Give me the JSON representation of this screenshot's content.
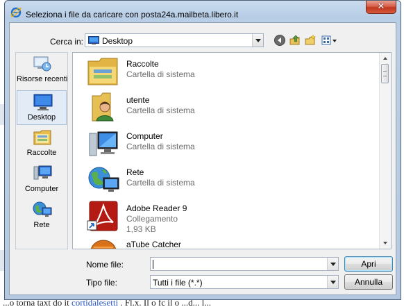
{
  "dialog": {
    "title": "Seleziona i file da caricare con posta24a.mailbeta.libero.it",
    "close_label": "✕"
  },
  "lookin": {
    "label": "Cerca in:",
    "value": "Desktop"
  },
  "toolbar": {
    "icons": [
      "back-icon",
      "up-folder-icon",
      "new-folder-icon",
      "view-menu-icon"
    ]
  },
  "places": [
    {
      "label": "Risorse recenti",
      "icon": "recent-places-icon"
    },
    {
      "label": "Desktop",
      "icon": "desktop-icon",
      "active": true
    },
    {
      "label": "Raccolte",
      "icon": "libraries-icon"
    },
    {
      "label": "Computer",
      "icon": "computer-icon"
    },
    {
      "label": "Rete",
      "icon": "network-icon"
    }
  ],
  "files": [
    {
      "name": "Raccolte",
      "desc": "Cartella di sistema",
      "icon": "libraries-icon"
    },
    {
      "name": "utente",
      "desc": "Cartella di sistema",
      "icon": "user-folder-icon"
    },
    {
      "name": "Computer",
      "desc": "Cartella di sistema",
      "icon": "computer-icon"
    },
    {
      "name": "Rete",
      "desc": "Cartella di sistema",
      "icon": "network-icon"
    },
    {
      "name": "Adobe Reader 9",
      "desc": "Collegamento",
      "size": "1,93 KB",
      "icon": "adobe-reader-icon"
    },
    {
      "name": "aTube Catcher",
      "icon": "atube-catcher-icon"
    }
  ],
  "filename": {
    "label": "Nome file:",
    "value": ""
  },
  "filetype": {
    "label": "Tipo file:",
    "value": "Tutti i file (*.*)"
  },
  "buttons": {
    "open": "Apri",
    "cancel": "Annulla"
  },
  "background_text": {
    "prefix": "...o torna taxt do it",
    "link": "cortidalesetti",
    "suffix": ". Fl.x. Il o fc il o ...d... l..."
  },
  "colors": {
    "close_button": "#c9452b",
    "frame": "#b9cde4",
    "client": "#f0f0f0"
  }
}
